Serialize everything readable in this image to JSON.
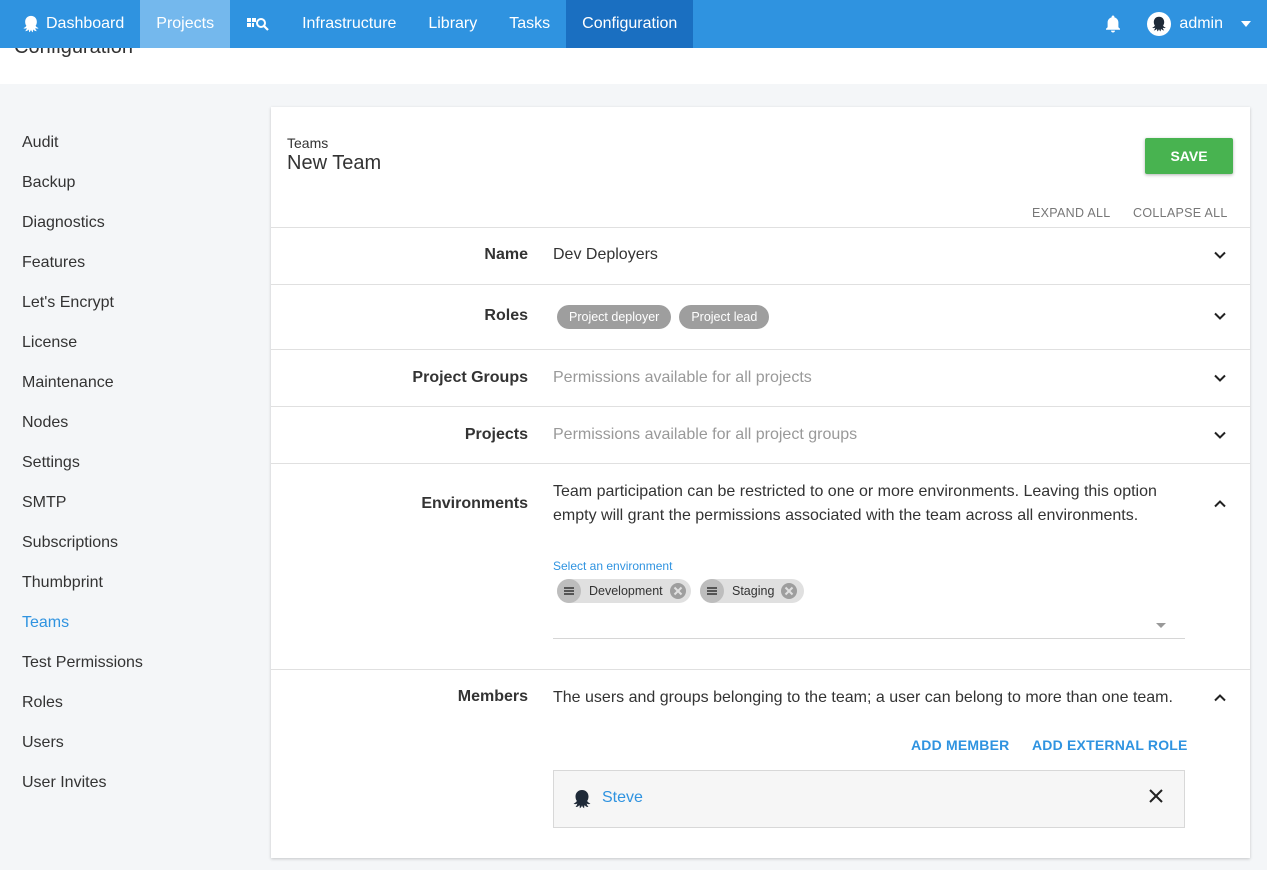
{
  "nav": {
    "dashboard": "Dashboard",
    "projects": "Projects",
    "infrastructure": "Infrastructure",
    "library": "Library",
    "tasks": "Tasks",
    "configuration": "Configuration",
    "user": "admin"
  },
  "page": {
    "title": "Configuration"
  },
  "sidebar": {
    "items": [
      "Audit",
      "Backup",
      "Diagnostics",
      "Features",
      "Let's Encrypt",
      "License",
      "Maintenance",
      "Nodes",
      "Settings",
      "SMTP",
      "Subscriptions",
      "Thumbprint",
      "Teams",
      "Test Permissions",
      "Roles",
      "Users",
      "User Invites"
    ],
    "active": "Teams"
  },
  "card": {
    "breadcrumb": "Teams",
    "title": "New Team",
    "save_label": "SAVE",
    "expand_all": "EXPAND ALL",
    "collapse_all": "COLLAPSE ALL"
  },
  "sections": {
    "name": {
      "label": "Name",
      "value": "Dev Deployers"
    },
    "roles": {
      "label": "Roles",
      "chips": [
        "Project deployer",
        "Project lead"
      ]
    },
    "project_groups": {
      "label": "Project Groups",
      "value": "Permissions available for all projects"
    },
    "projects": {
      "label": "Projects",
      "value": "Permissions available for all project groups"
    },
    "environments": {
      "label": "Environments",
      "description": "Team participation can be restricted to one or more environments. Leaving this option empty will grant the permissions associated with the team across all environments.",
      "field_label": "Select an environment",
      "chips": [
        "Development",
        "Staging"
      ]
    },
    "members": {
      "label": "Members",
      "description": "The users and groups belonging to the team; a user can belong to more than one team.",
      "add_member": "ADD MEMBER",
      "add_external_role": "ADD EXTERNAL ROLE",
      "items": [
        "Steve"
      ]
    }
  },
  "colors": {
    "primary": "#2f93e0",
    "save": "#48b350",
    "nav_active": "#1a6fc1"
  }
}
